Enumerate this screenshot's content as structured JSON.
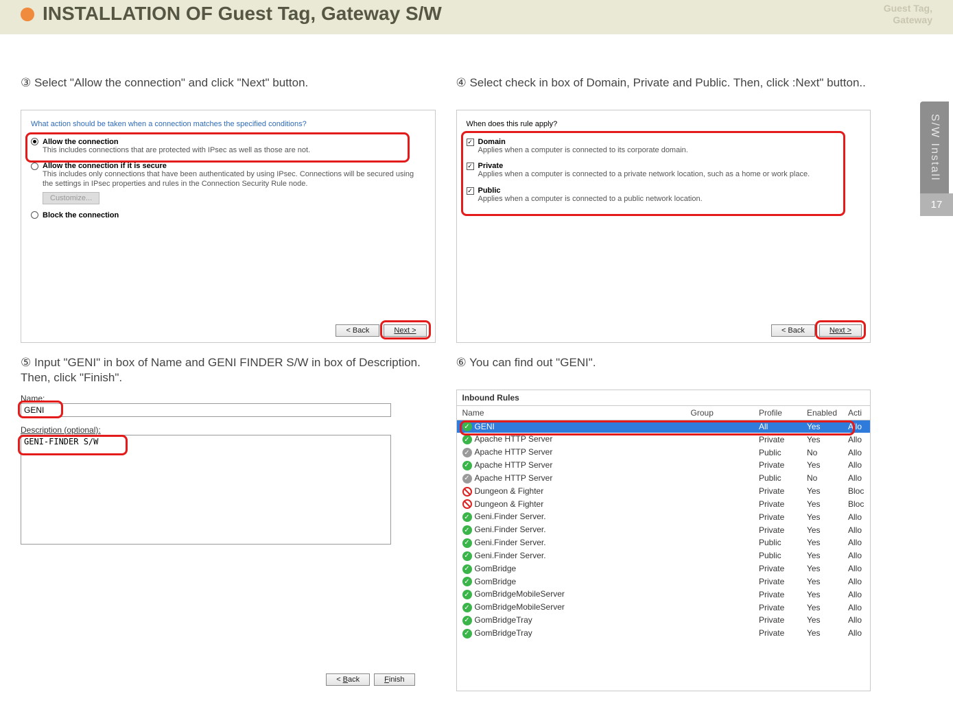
{
  "header": {
    "title": "INSTALLATION OF Guest Tag, Gateway S/W",
    "right1": "Guest Tag,",
    "right2": "Gateway"
  },
  "sidebar": {
    "label": "S/W Install",
    "page": "17"
  },
  "step3": {
    "caption": "③ Select \"Allow the connection\" and click \"Next\" button.",
    "question": "What action should be taken when a connection matches the specified conditions?",
    "opt1_title": "Allow the connection",
    "opt1_desc": "This includes connections that are protected with IPsec as well as those are not.",
    "opt2_title": "Allow the connection if it is secure",
    "opt2_desc": "This includes only connections that have been authenticated by using IPsec.  Connections will be secured using the settings in IPsec properties and rules in the Connection Security Rule node.",
    "customize": "Customize...",
    "opt3_title": "Block the connection",
    "back": "< Back",
    "next": "Next >"
  },
  "step4": {
    "caption": "④ Select check in box of Domain, Private and Public. Then, click :Next\" button..",
    "question": "When does this rule apply?",
    "d_title": "Domain",
    "d_desc": "Applies when a computer is connected to its corporate domain.",
    "p_title": "Private",
    "p_desc": "Applies when a computer is connected to a private network location, such as a home or work place.",
    "pu_title": "Public",
    "pu_desc": "Applies when a computer is connected to a public network location.",
    "back": "< Back",
    "next": "Next >"
  },
  "step5": {
    "caption": "⑤ Input \"GENI\" in box of Name and GENI FINDER S/W in box of Description. Then, click \"Finish\".",
    "name_label": "Name:",
    "name_value": "GENI",
    "desc_label": "Description (optional):",
    "desc_value": "GENI-FINDER S/W",
    "back": "< Back",
    "finish": "Finish"
  },
  "step6": {
    "caption": "⑥ You can find out \"GENI\".",
    "panel_title": "Inbound Rules",
    "cols": {
      "name": "Name",
      "group": "Group",
      "profile": "Profile",
      "enabled": "Enabled",
      "action": "Acti"
    },
    "rows": [
      {
        "icon": "g",
        "name": "GENI",
        "profile": "All",
        "enabled": "Yes",
        "action": "Allo",
        "selected": true
      },
      {
        "icon": "g",
        "name": "Apache HTTP Server",
        "profile": "Private",
        "enabled": "Yes",
        "action": "Allo"
      },
      {
        "icon": "gr",
        "name": "Apache HTTP Server",
        "profile": "Public",
        "enabled": "No",
        "action": "Allo"
      },
      {
        "icon": "g",
        "name": "Apache HTTP Server",
        "profile": "Private",
        "enabled": "Yes",
        "action": "Allo"
      },
      {
        "icon": "gr",
        "name": "Apache HTTP Server",
        "profile": "Public",
        "enabled": "No",
        "action": "Allo"
      },
      {
        "icon": "r",
        "name": "Dungeon & Fighter",
        "profile": "Private",
        "enabled": "Yes",
        "action": "Bloc"
      },
      {
        "icon": "r",
        "name": "Dungeon & Fighter",
        "profile": "Private",
        "enabled": "Yes",
        "action": "Bloc"
      },
      {
        "icon": "g",
        "name": "Geni.Finder Server.",
        "profile": "Private",
        "enabled": "Yes",
        "action": "Allo"
      },
      {
        "icon": "g",
        "name": "Geni.Finder Server.",
        "profile": "Private",
        "enabled": "Yes",
        "action": "Allo"
      },
      {
        "icon": "g",
        "name": "Geni.Finder Server.",
        "profile": "Public",
        "enabled": "Yes",
        "action": "Allo"
      },
      {
        "icon": "g",
        "name": "Geni.Finder Server.",
        "profile": "Public",
        "enabled": "Yes",
        "action": "Allo"
      },
      {
        "icon": "g",
        "name": "GomBridge",
        "profile": "Private",
        "enabled": "Yes",
        "action": "Allo"
      },
      {
        "icon": "g",
        "name": "GomBridge",
        "profile": "Private",
        "enabled": "Yes",
        "action": "Allo"
      },
      {
        "icon": "g",
        "name": "GomBridgeMobileServer",
        "profile": "Private",
        "enabled": "Yes",
        "action": "Allo"
      },
      {
        "icon": "g",
        "name": "GomBridgeMobileServer",
        "profile": "Private",
        "enabled": "Yes",
        "action": "Allo"
      },
      {
        "icon": "g",
        "name": "GomBridgeTray",
        "profile": "Private",
        "enabled": "Yes",
        "action": "Allo"
      },
      {
        "icon": "g",
        "name": "GomBridgeTray",
        "profile": "Private",
        "enabled": "Yes",
        "action": "Allo"
      }
    ]
  }
}
